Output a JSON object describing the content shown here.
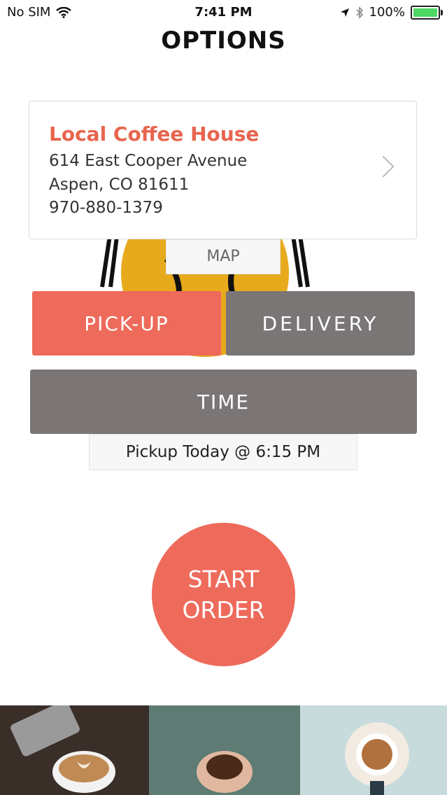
{
  "status_bar": {
    "carrier": "No SIM",
    "time": "7:41 PM",
    "battery": "100%"
  },
  "header": {
    "title": "OPTIONS"
  },
  "store": {
    "name": "Local Coffee House",
    "address_line1": "614 East Cooper Avenue",
    "address_line2": "Aspen, CO 81611",
    "phone": "970-880-1379"
  },
  "map_label": "MAP",
  "mode": {
    "pickup_label": "PICK-UP",
    "delivery_label": "DELIVERY",
    "selected": "PICK-UP"
  },
  "time": {
    "label": "TIME",
    "summary": "Pickup Today @ 6:15 PM"
  },
  "start_order": {
    "line1": "START",
    "line2": "ORDER"
  },
  "colors": {
    "accent": "#ee6a5b",
    "gray_button": "#7a7676",
    "battery": "#4cd964"
  }
}
